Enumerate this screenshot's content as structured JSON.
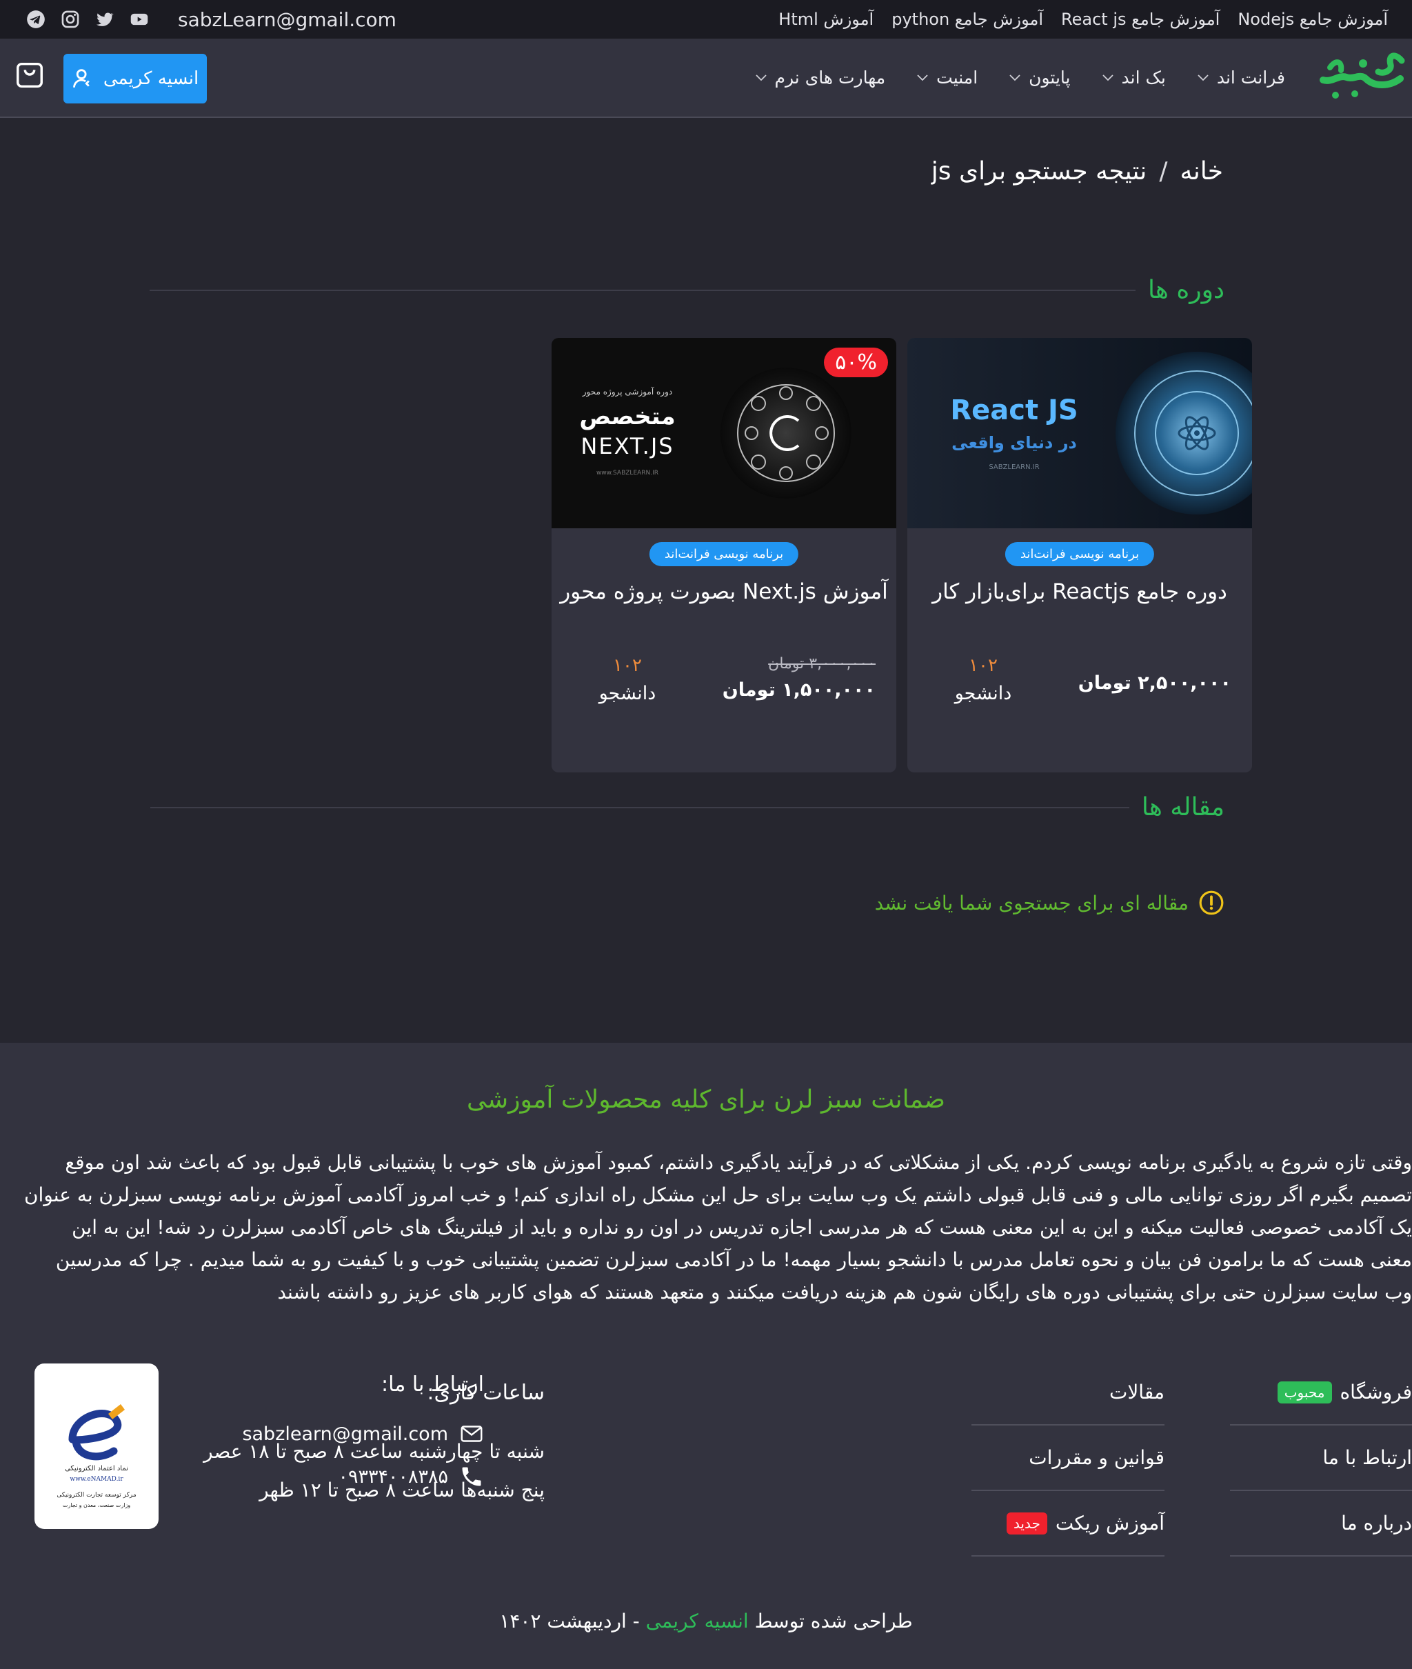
{
  "topbar": {
    "links": [
      "آموزش جامع Nodejs",
      "آموزش جامع React js",
      "آموزش جامع python",
      "آموزش Html"
    ],
    "email": "sabzLearn@gmail.com",
    "social_icons": [
      "telegram-icon",
      "instagram-icon",
      "twitter-icon",
      "youtube-icon"
    ]
  },
  "header": {
    "logo_text": "سبزلرن",
    "nav": [
      "فرانت اند",
      "بک اند",
      "پایتون",
      "امنیت",
      "مهارت های نرم"
    ],
    "user_button": "انسیه کریمی",
    "cart_icon": "shopping-bag-icon"
  },
  "breadcrumb": {
    "home": "خانه",
    "separator": "/",
    "current": "نتیجه جستجو برای js"
  },
  "courses_section": {
    "title": "دوره ها",
    "cards": [
      {
        "image_heading": "React JS",
        "image_subheading": "در دنیای واقعی",
        "image_site": "SABZLEARN.IR",
        "category": "برنامه نویسی فرانت‌اند",
        "title": "دوره جامع Reactjs برای‌بازار کار",
        "price": "۲,۵۰۰,۰۰۰",
        "currency": "تومان",
        "students_count": "۱۰۲",
        "students_label": "دانشجو"
      },
      {
        "image_kicker": "دوره آموزشی پروژه محور",
        "image_heading": "متخصص",
        "image_subheading": "NEXT.JS",
        "image_site": "www.SABZLEARN.IR",
        "discount": "۵۰%",
        "category": "برنامه نویسی فرانت‌اند",
        "title": "آموزش Next.js بصورت پروژه محور",
        "old_price": "۳,۰۰۰,۰۰۰ تومان",
        "price": "۱,۵۰۰,۰۰۰",
        "currency": "تومان",
        "students_count": "۱۰۲",
        "students_label": "دانشجو"
      }
    ]
  },
  "articles_section": {
    "title": "مقاله ها",
    "empty_message": "مقاله ای برای جستجوی شما یافت نشد"
  },
  "footer": {
    "guarantee_title": "ضمانت سبز لرن برای کلیه محصولات آموزشی",
    "guarantee_lines": [
      "وقتی تازه شروع به یادگیری برنامه نویسی کردم. یکی از مشکلاتی که در فرآیند یادگیری داشتم، کمبود آموزش های خوب با پشتیبانی قابل قبول بود که باعث شد اون موقع",
      "تصمیم بگیرم اگر روزی توانایی مالی و فنی قابل قبولی داشتم یک وب سایت برای حل این مشکل راه اندازی کنم! و خب امروز آکادمی آموزش برنامه نویسی سبزلرن به عنوان",
      "یک آکادمی خصوصی فعالیت میکنه و این به این معنی هست که هر مدرسی اجازه تدریس در اون رو نداره و باید از فیلترینگ های خاص آکادمی سبزلرن رد شه! این به این",
      "معنی هست که ما برامون فن بیان و نحوه تعامل مدرس با دانشجو بسیار مهمه! ما در آکادمی سبزلرن تضمین پشتیبانی خوب و با کیفیت رو به شما میدیم . چرا که مدرسین",
      "وب سایت سبزلرن حتی برای پشتیبانی دوره های رایگان شون هم هزینه دریافت میکنند و متعهد هستند که هوای کاربر های عزیز رو داشته باشند"
    ],
    "links_col1": [
      {
        "label": "فروشگاه",
        "badge": "محبوب"
      },
      {
        "label": "ارتباط با ما"
      },
      {
        "label": "درباره ما"
      }
    ],
    "links_col2": [
      {
        "label": "مقالات"
      },
      {
        "label": "قوانین و مقررات"
      },
      {
        "label": "آموزش ریکت",
        "badge": "جدید"
      }
    ],
    "hours": {
      "title": "ساعات کاری:",
      "line1": "شنبه تا چهارشنبه ساعت ۸ صبح تا ۱۸ عصر",
      "line2": "پنج شنبه‌ها ساعت ۸ صبح تا ۱۲ ظهر"
    },
    "contact": {
      "title": "ارتباط با ما:",
      "email": "sabzlearn@gmail.com",
      "phone": "۰۹۳۳۴۰۰۸۳۸۵"
    },
    "enamad": {
      "line1": "نماد اعتماد الکترونیکی",
      "line2": "www.eNAMAD.ir",
      "line3": "مرکز توسعه تجارت الکترونیکی",
      "line4": "وزارت صنعت، معدن و تجارت"
    },
    "credit": {
      "prefix": "طراحی شده توسط",
      "name": "انسیه کریمی",
      "suffix": "- اردیبهشت ۱۴۰۲"
    }
  },
  "colors": {
    "bg": "#26262f",
    "panel": "#33333f",
    "accent_green": "#2ebd59",
    "accent_blue": "#2196f3",
    "accent_red": "#f0212d",
    "students_orange": "#f08c3c"
  }
}
